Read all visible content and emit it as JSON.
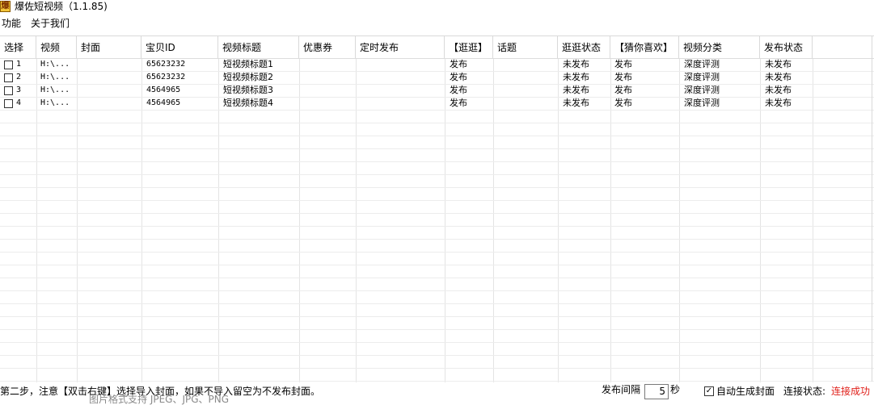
{
  "window": {
    "title": "爆佐短视频（1.1.85)",
    "icon_name": "app-logo-icon"
  },
  "menu": {
    "items": [
      "功能",
      "关于我们"
    ]
  },
  "table": {
    "columns": [
      "选择",
      "视频",
      "封面",
      "宝贝ID",
      "视频标题",
      "优惠券",
      "定时发布",
      "【逛逛】",
      "话题",
      "逛逛状态",
      "【猜你喜欢】",
      "视频分类",
      "发布状态"
    ],
    "rows": [
      {
        "num": "1",
        "video": "H:\\...",
        "cover": "",
        "id": "65623232",
        "title": "短视频标题1",
        "coupon": "",
        "scheduled": "",
        "guangguang": "发布",
        "topic": "",
        "gg_status": "未发布",
        "guess": "发布",
        "category": "深度评测",
        "publish_status": "未发布"
      },
      {
        "num": "2",
        "video": "H:\\...",
        "cover": "",
        "id": "65623232",
        "title": "短视频标题2",
        "coupon": "",
        "scheduled": "",
        "guangguang": "发布",
        "topic": "",
        "gg_status": "未发布",
        "guess": "发布",
        "category": "深度评测",
        "publish_status": "未发布"
      },
      {
        "num": "3",
        "video": "H:\\...",
        "cover": "",
        "id": "4564965",
        "title": "短视频标题3",
        "coupon": "",
        "scheduled": "",
        "guangguang": "发布",
        "topic": "",
        "gg_status": "未发布",
        "guess": "发布",
        "category": "深度评测",
        "publish_status": "未发布"
      },
      {
        "num": "4",
        "video": "H:\\...",
        "cover": "",
        "id": "4564965",
        "title": "短视频标题4",
        "coupon": "",
        "scheduled": "",
        "guangguang": "发布",
        "topic": "",
        "gg_status": "未发布",
        "guess": "发布",
        "category": "深度评测",
        "publish_status": "未发布"
      }
    ]
  },
  "status": {
    "hint": "第二步，注意【双击右键】选择导入封面，如果不导入留空为不发布封面。",
    "hint_sub": "图片格式支持 JPEG、JPG、PNG",
    "interval_label": "发布间隔",
    "interval_value": "5",
    "interval_unit": "秒",
    "auto_cover_label": "自动生成封面",
    "auto_cover_checked": true,
    "connection_label": "连接状态:",
    "connection_value": "连接成功",
    "connection_color": "#e0201a"
  }
}
